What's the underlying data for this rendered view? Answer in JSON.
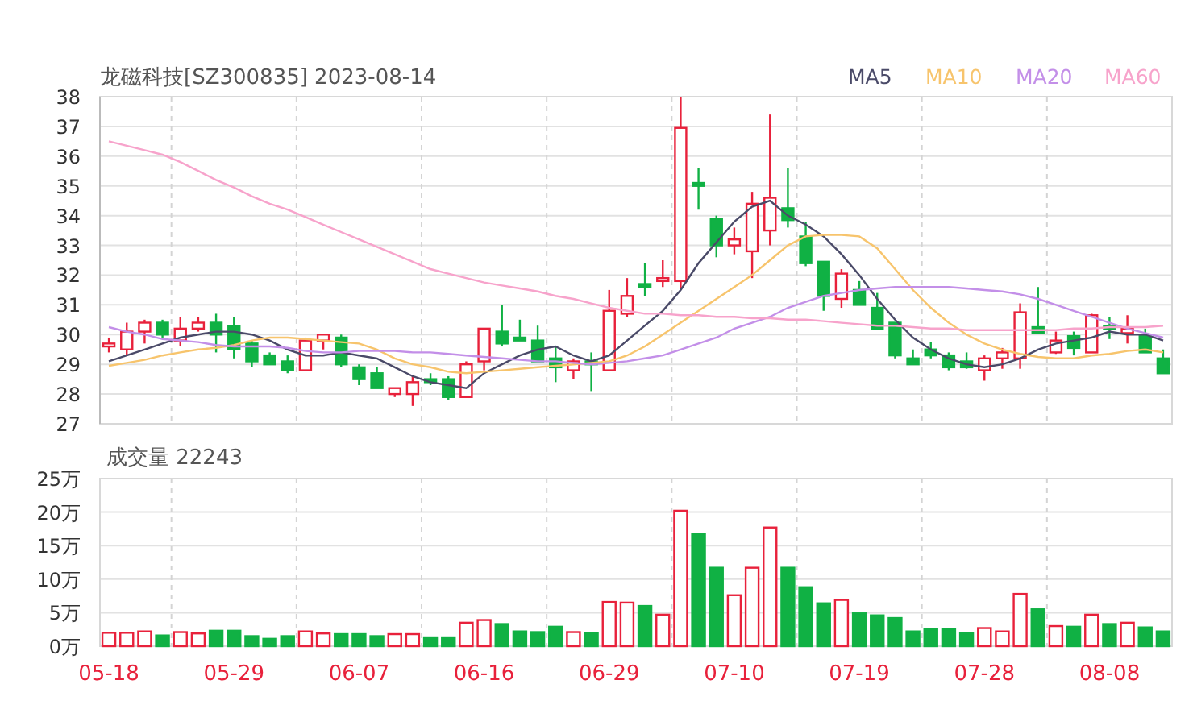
{
  "price_chart": {
    "chart_data": {
      "type": "candlestick",
      "title": "龙磁科技[SZ300835] 2023-08-14",
      "grid": true,
      "ylim": [
        27,
        38
      ],
      "yticks": [
        27,
        28,
        29,
        30,
        31,
        32,
        33,
        34,
        35,
        36,
        37,
        38
      ],
      "categories": [
        null,
        null,
        null,
        null,
        null,
        null,
        null,
        null,
        null,
        null,
        null,
        null,
        null,
        null,
        null,
        null,
        null,
        null,
        null,
        null,
        null,
        null,
        null,
        null,
        null,
        null,
        null,
        null,
        null,
        null,
        null,
        null,
        null,
        null,
        null,
        null,
        null,
        null,
        null,
        null,
        null,
        null,
        null,
        null,
        null,
        null,
        null,
        null,
        null,
        null,
        null,
        null,
        null,
        null,
        null,
        null,
        null,
        null,
        null,
        null
      ],
      "ohlc": [
        [
          29.6,
          29.9,
          29.4,
          29.7
        ],
        [
          29.5,
          30.4,
          29.3,
          30.1
        ],
        [
          30.1,
          30.5,
          29.7,
          30.4
        ],
        [
          30.4,
          30.5,
          29.9,
          30.0
        ],
        [
          29.8,
          30.6,
          29.6,
          30.2
        ],
        [
          30.2,
          30.6,
          30.1,
          30.4
        ],
        [
          30.4,
          30.7,
          29.4,
          30.0
        ],
        [
          30.3,
          30.6,
          29.2,
          29.5
        ],
        [
          29.7,
          29.8,
          28.9,
          29.1
        ],
        [
          29.3,
          29.4,
          29.0,
          29.0
        ],
        [
          29.1,
          29.3,
          28.7,
          28.8
        ],
        [
          28.8,
          29.9,
          28.8,
          29.8
        ],
        [
          29.8,
          30.0,
          29.5,
          30.0
        ],
        [
          29.9,
          30.0,
          28.9,
          29.0
        ],
        [
          28.9,
          29.0,
          28.3,
          28.5
        ],
        [
          28.7,
          28.9,
          28.2,
          28.2
        ],
        [
          28.0,
          28.2,
          27.9,
          28.2
        ],
        [
          28.0,
          28.6,
          27.6,
          28.4
        ],
        [
          28.5,
          28.7,
          28.3,
          28.4
        ],
        [
          28.5,
          28.6,
          27.8,
          27.9
        ],
        [
          27.9,
          29.1,
          27.9,
          29.0
        ],
        [
          29.1,
          30.2,
          28.8,
          30.2
        ],
        [
          30.1,
          31.0,
          29.6,
          29.7
        ],
        [
          29.9,
          30.5,
          29.8,
          29.8
        ],
        [
          29.8,
          30.3,
          29.1,
          29.1
        ],
        [
          29.2,
          29.6,
          28.4,
          28.9
        ],
        [
          28.8,
          29.2,
          28.5,
          29.1
        ],
        [
          29.1,
          29.4,
          28.1,
          29.0
        ],
        [
          28.8,
          31.5,
          28.8,
          30.8
        ],
        [
          30.7,
          31.9,
          30.6,
          31.3
        ],
        [
          31.7,
          32.4,
          31.3,
          31.6
        ],
        [
          31.8,
          32.5,
          31.6,
          31.9
        ],
        [
          31.8,
          38.0,
          31.5,
          36.95
        ],
        [
          35.1,
          35.6,
          34.2,
          35.0
        ],
        [
          33.9,
          34.0,
          32.6,
          33.0
        ],
        [
          33.0,
          33.6,
          32.7,
          33.2
        ],
        [
          32.8,
          34.8,
          31.9,
          34.4
        ],
        [
          33.5,
          37.4,
          33.0,
          34.6
        ],
        [
          34.25,
          35.6,
          33.6,
          33.85
        ],
        [
          33.3,
          33.8,
          32.3,
          32.4
        ],
        [
          32.45,
          32.45,
          30.8,
          31.3
        ],
        [
          31.2,
          32.2,
          30.9,
          32.05
        ],
        [
          31.5,
          31.8,
          31.0,
          31.0
        ],
        [
          30.9,
          31.4,
          30.2,
          30.2
        ],
        [
          30.4,
          30.4,
          29.2,
          29.3
        ],
        [
          29.2,
          29.5,
          29.0,
          29.0
        ],
        [
          29.5,
          29.75,
          29.2,
          29.3
        ],
        [
          29.3,
          29.4,
          28.8,
          28.9
        ],
        [
          29.1,
          29.4,
          28.85,
          28.9
        ],
        [
          28.8,
          29.3,
          28.45,
          29.2
        ],
        [
          29.2,
          29.55,
          28.85,
          29.4
        ],
        [
          29.2,
          31.05,
          28.85,
          30.75
        ],
        [
          30.25,
          31.6,
          30.05,
          30.05
        ],
        [
          29.4,
          30.1,
          29.35,
          29.8
        ],
        [
          29.95,
          30.1,
          29.3,
          29.55
        ],
        [
          29.4,
          30.7,
          29.4,
          30.65
        ],
        [
          30.3,
          30.6,
          29.85,
          30.2
        ],
        [
          30.05,
          30.65,
          29.7,
          30.2
        ],
        [
          30.0,
          30.2,
          29.4,
          29.4
        ],
        [
          29.2,
          29.5,
          28.7,
          28.7
        ]
      ]
    }
  },
  "moving_averages": {
    "chart_data": {
      "type": "line",
      "ylim": [
        27,
        38
      ],
      "categories": [
        null,
        null,
        null,
        null,
        null,
        null,
        null,
        null,
        null,
        null,
        null,
        null,
        null,
        null,
        null,
        null,
        null,
        null,
        null,
        null,
        null,
        null,
        null,
        null,
        null,
        null,
        null,
        null,
        null,
        null,
        null,
        null,
        null,
        null,
        null,
        null,
        null,
        null,
        null,
        null,
        null,
        null,
        null,
        null,
        null,
        null,
        null,
        null,
        null,
        null,
        null,
        null,
        null,
        null,
        null,
        null,
        null,
        null,
        null,
        null
      ],
      "series": [
        {
          "name": "MA5",
          "color": "#4a4a68",
          "values": [
            29.1,
            29.3,
            29.5,
            29.7,
            29.9,
            30.0,
            30.1,
            30.1,
            30.0,
            29.8,
            29.5,
            29.3,
            29.3,
            29.4,
            29.3,
            29.2,
            28.9,
            28.6,
            28.4,
            28.3,
            28.2,
            28.7,
            29.0,
            29.3,
            29.5,
            29.6,
            29.3,
            29.1,
            29.3,
            29.8,
            30.3,
            30.8,
            31.5,
            32.4,
            33.1,
            33.8,
            34.3,
            34.5,
            34.0,
            33.7,
            33.3,
            32.7,
            32.0,
            31.2,
            30.5,
            29.9,
            29.5,
            29.2,
            29.0,
            28.9,
            29.0,
            29.2,
            29.5,
            29.7,
            29.8,
            29.9,
            30.1,
            30.0,
            30.0,
            29.8
          ]
        },
        {
          "name": "MA10",
          "color": "#f7c46c",
          "values": [
            28.95,
            29.05,
            29.15,
            29.3,
            29.4,
            29.5,
            29.55,
            29.65,
            29.8,
            29.9,
            29.9,
            29.85,
            29.8,
            29.75,
            29.7,
            29.5,
            29.2,
            29.0,
            28.9,
            28.75,
            28.7,
            28.75,
            28.8,
            28.85,
            28.9,
            28.95,
            29.0,
            29.05,
            29.1,
            29.3,
            29.6,
            30.0,
            30.4,
            30.8,
            31.2,
            31.6,
            32.0,
            32.5,
            33.0,
            33.3,
            33.35,
            33.35,
            33.3,
            32.9,
            32.2,
            31.5,
            30.9,
            30.4,
            30.0,
            29.7,
            29.5,
            29.35,
            29.25,
            29.2,
            29.2,
            29.3,
            29.35,
            29.45,
            29.5,
            29.4
          ]
        },
        {
          "name": "MA20",
          "color": "#c38fe8",
          "values": [
            30.25,
            30.1,
            30.0,
            29.85,
            29.8,
            29.75,
            29.65,
            29.6,
            29.6,
            29.6,
            29.55,
            29.45,
            29.4,
            29.4,
            29.45,
            29.45,
            29.45,
            29.4,
            29.4,
            29.35,
            29.3,
            29.25,
            29.2,
            29.15,
            29.1,
            29.1,
            29.05,
            29.0,
            29.05,
            29.1,
            29.2,
            29.3,
            29.5,
            29.7,
            29.9,
            30.2,
            30.4,
            30.6,
            30.9,
            31.1,
            31.3,
            31.4,
            31.5,
            31.55,
            31.6,
            31.6,
            31.6,
            31.6,
            31.55,
            31.5,
            31.45,
            31.35,
            31.2,
            31.0,
            30.8,
            30.6,
            30.4,
            30.2,
            30.05,
            29.9
          ]
        },
        {
          "name": "MA60",
          "color": "#f7a3cb",
          "values": [
            36.5,
            36.35,
            36.2,
            36.05,
            35.8,
            35.5,
            35.2,
            34.95,
            34.65,
            34.4,
            34.2,
            33.95,
            33.7,
            33.45,
            33.2,
            32.95,
            32.7,
            32.45,
            32.2,
            32.05,
            31.9,
            31.75,
            31.65,
            31.55,
            31.45,
            31.3,
            31.2,
            31.05,
            30.9,
            30.8,
            30.7,
            30.7,
            30.65,
            30.65,
            30.6,
            30.6,
            30.55,
            30.55,
            30.5,
            30.5,
            30.45,
            30.4,
            30.35,
            30.3,
            30.3,
            30.25,
            30.2,
            30.2,
            30.15,
            30.15,
            30.15,
            30.15,
            30.15,
            30.15,
            30.2,
            30.2,
            30.25,
            30.25,
            30.25,
            30.3
          ]
        }
      ]
    }
  },
  "volume_chart": {
    "chart_data": {
      "type": "bar",
      "title": "成交量 22243",
      "grid": true,
      "ylim": [
        0,
        25
      ],
      "yticks": [
        {
          "value": 0,
          "label": "0万"
        },
        {
          "value": 5,
          "label": "5万"
        },
        {
          "value": 10,
          "label": "10万"
        },
        {
          "value": 15,
          "label": "15万"
        },
        {
          "value": 20,
          "label": "20万"
        },
        {
          "value": 25,
          "label": "25万"
        }
      ],
      "categories": [
        "05-18",
        null,
        null,
        null,
        null,
        null,
        null,
        "05-29",
        null,
        null,
        null,
        null,
        null,
        null,
        "06-07",
        null,
        null,
        null,
        null,
        null,
        null,
        "06-16",
        null,
        null,
        null,
        null,
        null,
        null,
        "06-29",
        null,
        null,
        null,
        null,
        null,
        null,
        "07-10",
        null,
        null,
        null,
        null,
        null,
        null,
        "07-19",
        null,
        null,
        null,
        null,
        null,
        null,
        "07-28",
        null,
        null,
        null,
        null,
        null,
        null,
        "08-08",
        null,
        null,
        null
      ],
      "values": [
        2.0,
        2.0,
        2.2,
        1.6,
        2.1,
        1.9,
        2.3,
        2.3,
        1.5,
        1.1,
        1.5,
        2.2,
        1.9,
        1.8,
        1.8,
        1.5,
        1.8,
        1.8,
        1.2,
        1.2,
        3.5,
        3.9,
        3.3,
        2.2,
        2.1,
        2.9,
        2.1,
        2.0,
        6.6,
        6.5,
        6.0,
        4.7,
        20.2,
        16.8,
        11.7,
        7.6,
        11.7,
        17.7,
        11.7,
        8.8,
        6.4,
        6.9,
        4.9,
        4.6,
        4.2,
        2.2,
        2.5,
        2.5,
        1.9,
        2.7,
        2.2,
        7.8,
        5.5,
        3.0,
        2.9,
        4.7,
        3.3,
        3.5,
        2.8,
        2.2
      ]
    }
  }
}
